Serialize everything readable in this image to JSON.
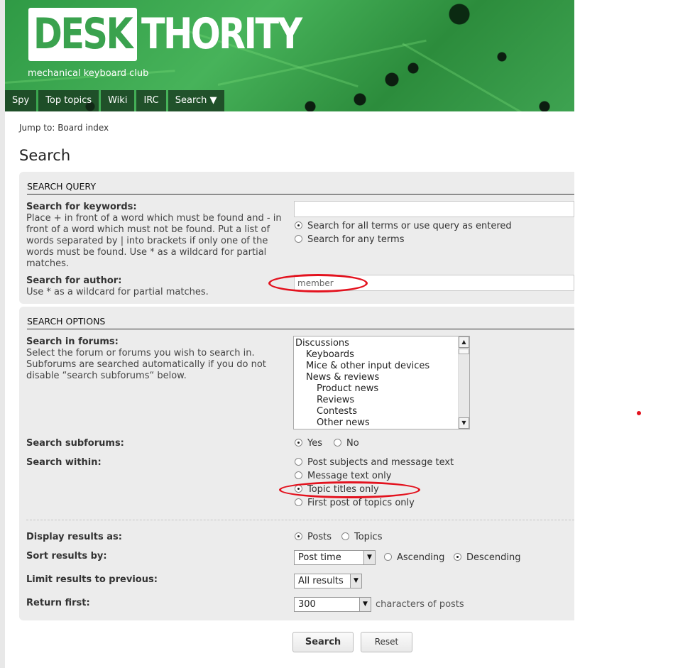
{
  "header": {
    "logo_part1": "DESK",
    "logo_part2": "THORITY",
    "tagline": "mechanical keyboard club",
    "nav": [
      "Spy",
      "Top topics",
      "Wiki",
      "IRC",
      "Search ▼"
    ]
  },
  "breadcrumb": {
    "prefix": "Jump to:",
    "link": "Board index"
  },
  "page_title": "Search",
  "search_query": {
    "heading": "SEARCH QUERY",
    "keywords_label": "Search for keywords:",
    "keywords_hint": "Place + in front of a word which must be found and - in front of a word which must not be found. Put a list of words separated by | into brackets if only one of the words must be found. Use * as a wildcard for partial matches.",
    "keywords_value": "",
    "terms_options": [
      {
        "label": "Search for all terms or use query as entered",
        "checked": true
      },
      {
        "label": "Search for any terms",
        "checked": false
      }
    ],
    "author_label": "Search for author:",
    "author_hint": "Use * as a wildcard for partial matches.",
    "author_value": "member"
  },
  "search_options": {
    "heading": "SEARCH OPTIONS",
    "forums_label": "Search in forums:",
    "forums_hint": "Select the forum or forums you wish to search in. Subforums are searched automatically if you do not disable “search subforums“ below.",
    "forums": [
      {
        "name": "Discussions",
        "level": 0
      },
      {
        "name": "Keyboards",
        "level": 1
      },
      {
        "name": "Mice & other input devices",
        "level": 1
      },
      {
        "name": "News & reviews",
        "level": 1
      },
      {
        "name": "Product news",
        "level": 2
      },
      {
        "name": "Reviews",
        "level": 2
      },
      {
        "name": "Contests",
        "level": 2
      },
      {
        "name": "Other news",
        "level": 2
      }
    ],
    "subforums_label": "Search subforums:",
    "subforums_yes": "Yes",
    "subforums_no": "No",
    "within_label": "Search within:",
    "within_options": [
      {
        "label": "Post subjects and message text",
        "checked": false
      },
      {
        "label": "Message text only",
        "checked": false
      },
      {
        "label": "Topic titles only",
        "checked": true
      },
      {
        "label": "First post of topics only",
        "checked": false
      }
    ],
    "display_label": "Display results as:",
    "display_posts": "Posts",
    "display_topics": "Topics",
    "sort_label": "Sort results by:",
    "sort_value": "Post time",
    "sort_asc": "Ascending",
    "sort_desc": "Descending",
    "limit_label": "Limit results to previous:",
    "limit_value": "All results",
    "return_label": "Return first:",
    "return_value": "300",
    "return_suffix": "characters of posts"
  },
  "buttons": {
    "search": "Search",
    "reset": "Reset"
  },
  "colors": {
    "brand_green": "#3aa24e",
    "annotation_red": "#e3121e",
    "panel_bg": "#ececec"
  }
}
